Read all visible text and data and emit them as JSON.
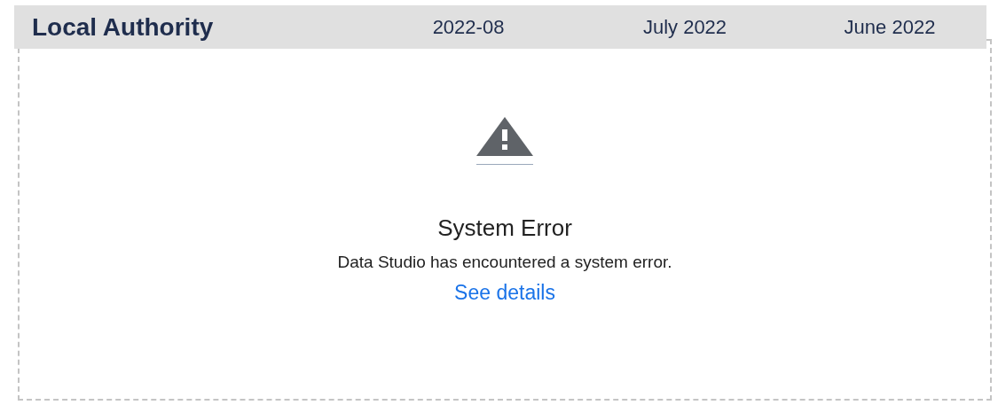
{
  "table_header": {
    "title": "Local Authority",
    "columns": [
      "2022-08",
      "July 2022",
      "June 2022"
    ]
  },
  "error": {
    "title": "System Error",
    "message": "Data Studio has encountered a system error.",
    "link": "See details"
  }
}
